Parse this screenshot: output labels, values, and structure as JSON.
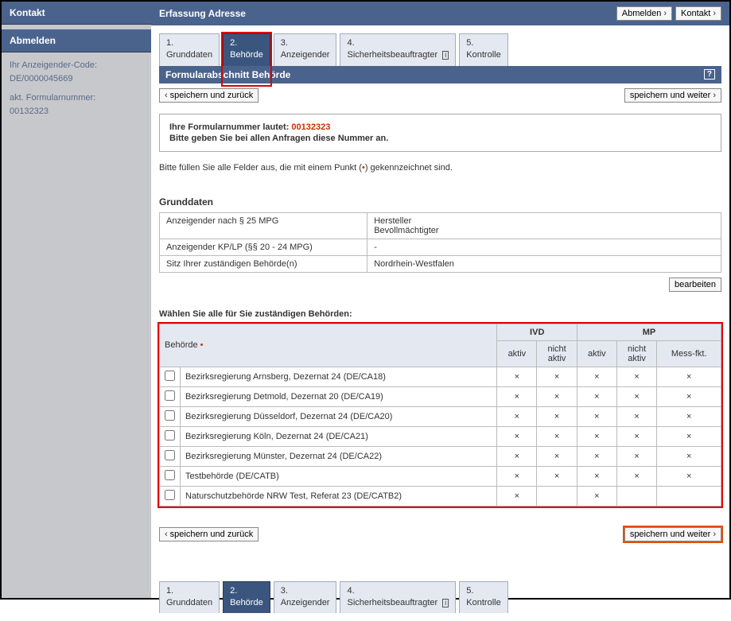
{
  "sidebar": {
    "kontakt_label": "Kontakt",
    "abmelden_label": "Abmelden",
    "code_label": "Ihr Anzeigender-Code:",
    "code_value": "DE/0000045669",
    "formnr_label": "akt. Formularnummer:",
    "formnr_value": "00132323"
  },
  "header": {
    "title": "Erfassung Adresse",
    "btn_abmelden": "Abmelden",
    "btn_kontakt": "Kontakt"
  },
  "tabs": [
    {
      "num": "1.",
      "label": "Grunddaten",
      "active": false
    },
    {
      "num": "2.",
      "label": "Behörde",
      "active": true
    },
    {
      "num": "3.",
      "label": "Anzeigender",
      "active": false
    },
    {
      "num": "4.",
      "label": "Sicherheitsbeauftragter",
      "active": false,
      "info": true
    },
    {
      "num": "5.",
      "label": "Kontrolle",
      "active": false
    }
  ],
  "section_title": "Formularabschnitt Behörde",
  "btn_back": "speichern und zurück",
  "btn_fwd": "speichern und weiter",
  "formnum": {
    "line1_prefix": "Ihre Formularnummer lautet: ",
    "number": "00132323",
    "line2": "Bitte geben Sie bei allen Anfragen diese Nummer an."
  },
  "instruction_pre": "Bitte füllen Sie alle Felder aus, die mit einem Punkt (",
  "instruction_post": ") gekennzeichnet sind.",
  "grunddaten_heading": "Grunddaten",
  "kv_rows": [
    {
      "k": "Anzeigender nach § 25 MPG",
      "v": "Hersteller\nBevollmächtigter"
    },
    {
      "k": "Anzeigender KP/LP (§§ 20 - 24 MPG)",
      "v": "-"
    },
    {
      "k": "Sitz Ihrer zuständigen Behörde(n)",
      "v": "Nordrhein-Westfalen"
    }
  ],
  "btn_bearbeiten": "bearbeiten",
  "choose_label": "Wählen Sie alle für Sie zuständigen Behörden:",
  "matrix": {
    "col_behoerde": "Behörde",
    "group_ivd": "IVD",
    "group_mp": "MP",
    "col_aktiv": "aktiv",
    "col_nicht_aktiv": "nicht aktiv",
    "col_messfkt": "Mess-fkt.",
    "rows": [
      {
        "name": "Bezirksregierung Arnsberg, Dezernat 24 (DE/CA18)",
        "ivd_a": "×",
        "ivd_n": "×",
        "mp_a": "×",
        "mp_n": "×",
        "mp_m": "×"
      },
      {
        "name": "Bezirksregierung Detmold, Dezernat 20 (DE/CA19)",
        "ivd_a": "×",
        "ivd_n": "×",
        "mp_a": "×",
        "mp_n": "×",
        "mp_m": "×"
      },
      {
        "name": "Bezirksregierung Düsseldorf, Dezernat 24 (DE/CA20)",
        "ivd_a": "×",
        "ivd_n": "×",
        "mp_a": "×",
        "mp_n": "×",
        "mp_m": "×"
      },
      {
        "name": "Bezirksregierung Köln, Dezernat 24 (DE/CA21)",
        "ivd_a": "×",
        "ivd_n": "×",
        "mp_a": "×",
        "mp_n": "×",
        "mp_m": "×"
      },
      {
        "name": "Bezirksregierung Münster, Dezernat 24 (DE/CA22)",
        "ivd_a": "×",
        "ivd_n": "×",
        "mp_a": "×",
        "mp_n": "×",
        "mp_m": "×"
      },
      {
        "name": "Testbehörde (DE/CATB)",
        "ivd_a": "×",
        "ivd_n": "×",
        "mp_a": "×",
        "mp_n": "×",
        "mp_m": "×"
      },
      {
        "name": "Naturschutzbehörde NRW Test, Referat 23 (DE/CATB2)",
        "ivd_a": "×",
        "ivd_n": "",
        "mp_a": "×",
        "mp_n": "",
        "mp_m": ""
      }
    ]
  }
}
